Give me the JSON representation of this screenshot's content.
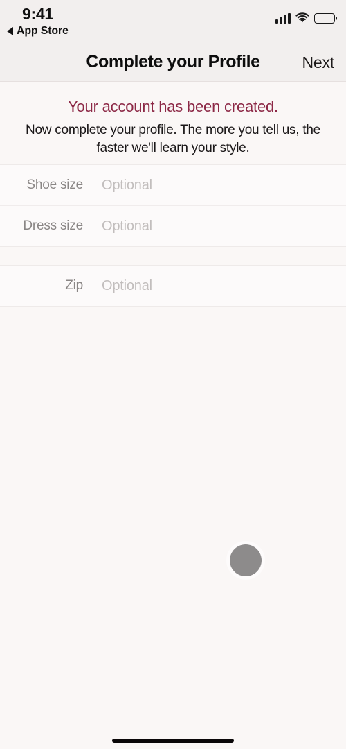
{
  "status_bar": {
    "time": "9:41",
    "back_label": "App Store",
    "back_icon": "back-triangle-icon",
    "signal_icon": "cellular-signal-icon",
    "wifi_icon": "wifi-icon",
    "battery_icon": "battery-full-icon"
  },
  "nav": {
    "title": "Complete your Profile",
    "next_label": "Next"
  },
  "intro": {
    "headline": "Your account has been created.",
    "subtext": "Now complete your profile. The more you tell us, the faster we'll learn your style."
  },
  "form": {
    "sections": [
      {
        "rows": [
          {
            "label": "Shoe size",
            "value": "",
            "placeholder": "Optional"
          },
          {
            "label": "Dress size",
            "value": "",
            "placeholder": "Optional"
          }
        ]
      },
      {
        "rows": [
          {
            "label": "Zip",
            "value": "",
            "placeholder": "Optional"
          }
        ]
      }
    ]
  },
  "overlay": {
    "assistive_touch_icon": "assistive-touch-button",
    "home_indicator": "home-indicator-bar"
  },
  "colors": {
    "accent_maroon": "#8c2846",
    "nav_background": "#f2efee",
    "page_background": "#faf7f6",
    "field_background": "#fcfafa",
    "label_gray": "#8a8685",
    "placeholder_gray": "#c2bebd"
  }
}
